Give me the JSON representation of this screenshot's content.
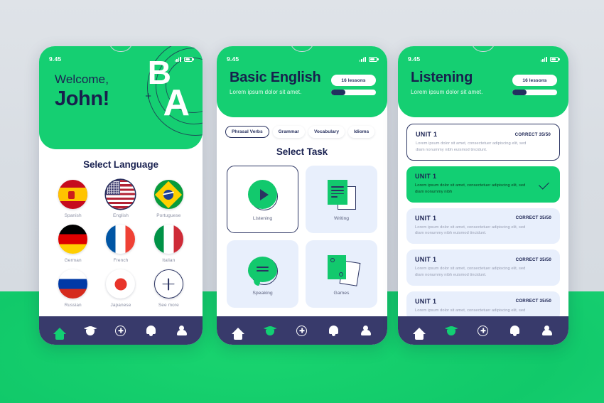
{
  "statusbar": {
    "time": "9.45",
    "signal_icon": "signal-bars-icon",
    "battery_icon": "battery-icon"
  },
  "phone1": {
    "greeting_line1": "Welcome,",
    "greeting_line2": "John!",
    "deco_b": "B",
    "deco_plus": "+",
    "deco_a": "A",
    "section_title": "Select Language",
    "languages": [
      {
        "label": "Spanish",
        "flag": "flag-spain-icon",
        "selected": false
      },
      {
        "label": "English",
        "flag": "flag-usa-icon",
        "selected": true
      },
      {
        "label": "Portuguese",
        "flag": "flag-brazil-icon",
        "selected": false
      },
      {
        "label": "German",
        "flag": "flag-germany-icon",
        "selected": false
      },
      {
        "label": "French",
        "flag": "flag-france-icon",
        "selected": false
      },
      {
        "label": "Italian",
        "flag": "flag-italy-icon",
        "selected": false
      },
      {
        "label": "Russian",
        "flag": "flag-russia-icon",
        "selected": false
      },
      {
        "label": "Japanese",
        "flag": "flag-japan-icon",
        "selected": false
      },
      {
        "label": "See more",
        "flag": "plus-circle-icon",
        "selected": false
      }
    ]
  },
  "phone2": {
    "title": "Basic English",
    "subtitle": "Lorem ipsum dolor sit amet.",
    "lessons_badge": "16 lessons",
    "progress_percent": 32,
    "chips": [
      {
        "label": "Phrasal Verbs",
        "active": true
      },
      {
        "label": "Grammar",
        "active": false
      },
      {
        "label": "Vocabulary",
        "active": false
      },
      {
        "label": "Idioms",
        "active": false
      }
    ],
    "section_title": "Select Task",
    "tasks": [
      {
        "label": "Listening",
        "icon": "play-circle-icon",
        "active": true
      },
      {
        "label": "Writing",
        "icon": "document-icon",
        "active": false
      },
      {
        "label": "Speaking",
        "icon": "speech-bubble-icon",
        "active": false
      },
      {
        "label": "Games",
        "icon": "cards-icon",
        "active": false
      }
    ]
  },
  "phone3": {
    "title": "Listening",
    "subtitle": "Lorem ipsum dolor sit amet.",
    "lessons_badge": "16 lessons",
    "progress_percent": 32,
    "units": [
      {
        "title": "UNIT 1",
        "correct": "CORRECT 35/50",
        "desc": "Lorem ipsum dolor sit amet, consectetuer adipiscing elit, sed diam nonummy nibh euismod tincidunt.",
        "state": "outline"
      },
      {
        "title": "UNIT 1",
        "correct": "",
        "desc": "Lorem ipsum dolor sit amet, consectetuer adipiscing elit, sed diam nonummy nibh",
        "state": "done"
      },
      {
        "title": "UNIT 1",
        "correct": "CORRECT 35/50",
        "desc": "Lorem ipsum dolor sit amet, consectetuer adipiscing elit, sed diam nonummy nibh euismod tincidunt.",
        "state": "plain"
      },
      {
        "title": "UNIT 1",
        "correct": "CORRECT 35/50",
        "desc": "Lorem ipsum dolor sit amet, consectetuer adipiscing elit, sed diam nonummy nibh euismod tincidunt.",
        "state": "plain"
      },
      {
        "title": "UNIT 1",
        "correct": "CORRECT 35/50",
        "desc": "Lorem ipsum dolor sit amet, consectetuer adipiscing elit, sed",
        "state": "plain"
      }
    ]
  },
  "nav": {
    "items": [
      {
        "icon": "home-icon",
        "label": "Home"
      },
      {
        "icon": "graduation-cap-icon",
        "label": "Learn"
      },
      {
        "icon": "plus-circle-icon",
        "label": "Add"
      },
      {
        "icon": "bell-icon",
        "label": "Notifications"
      },
      {
        "icon": "user-icon",
        "label": "Profile"
      }
    ],
    "active_phone1": 0,
    "active_phone2": 1,
    "active_phone3": 1
  },
  "colors": {
    "green": "#12cf73",
    "navy": "#1b2352",
    "nav_bg": "#383a6b",
    "card_blue": "#e8effc"
  }
}
